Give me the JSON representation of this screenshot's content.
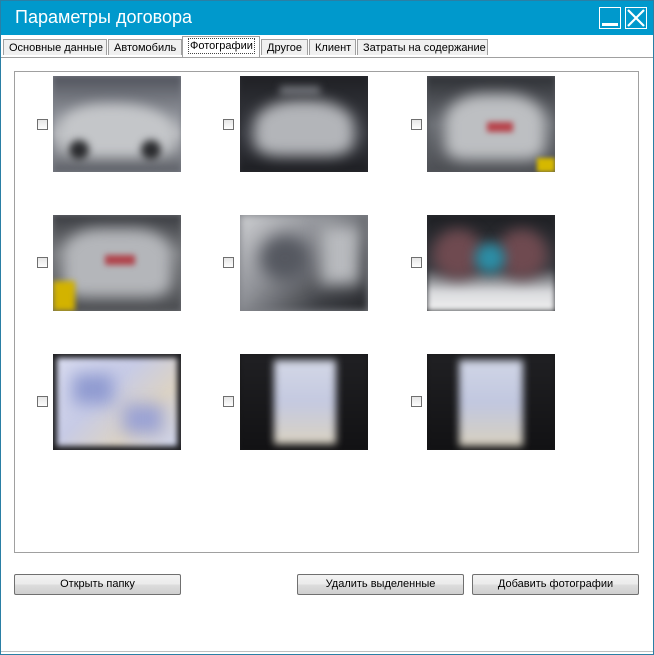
{
  "window": {
    "title": "Параметры договора"
  },
  "tabs": [
    {
      "label": "Основные данные",
      "active": false
    },
    {
      "label": "Автомобиль",
      "active": false
    },
    {
      "label": "Фотографии",
      "active": true
    },
    {
      "label": "Другое",
      "active": false
    },
    {
      "label": "Клиент",
      "active": false
    },
    {
      "label": "Затраты на содержание",
      "active": false
    }
  ],
  "photos": [
    {
      "kind": "car-side-front",
      "checked": false
    },
    {
      "kind": "car-front",
      "checked": false
    },
    {
      "kind": "car-rear",
      "checked": false
    },
    {
      "kind": "car-rear-side",
      "checked": false
    },
    {
      "kind": "car-interior",
      "checked": false
    },
    {
      "kind": "car-dashboard",
      "checked": false
    },
    {
      "kind": "document",
      "checked": false
    },
    {
      "kind": "document-on-dark",
      "checked": false
    },
    {
      "kind": "document-on-dark",
      "checked": false
    }
  ],
  "buttons": {
    "open_folder": "Открыть папку",
    "delete_selected": "Удалить выделенные",
    "add_photos": "Добавить фотографии"
  },
  "colors": {
    "titlebar": "#0099cc",
    "title_text": "#ffffff"
  }
}
